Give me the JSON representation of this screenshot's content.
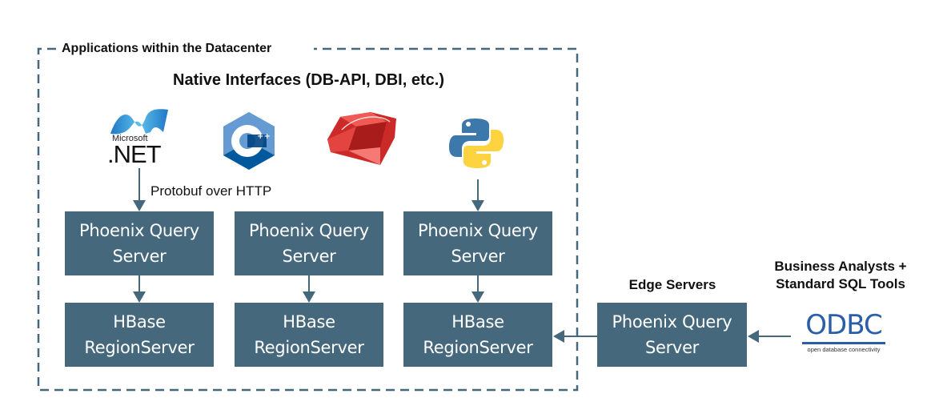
{
  "container": {
    "title": "Applications within the Datacenter",
    "subtitle": "Native Interfaces (DB-API, DBI, etc.)"
  },
  "logos": [
    {
      "name": "dotnet",
      "text_top": "Microsoft",
      "text_main": ".NET"
    },
    {
      "name": "cpp",
      "text": "C++"
    },
    {
      "name": "ruby"
    },
    {
      "name": "python"
    }
  ],
  "connector_label": "Protobuf over HTTP",
  "query_servers": [
    {
      "label": "Phoenix Query\nServer"
    },
    {
      "label": "Phoenix Query\nServer"
    },
    {
      "label": "Phoenix Query\nServer"
    }
  ],
  "region_servers": [
    {
      "label": "HBase\nRegionServer"
    },
    {
      "label": "HBase\nRegionServer"
    },
    {
      "label": "HBase\nRegionServer"
    }
  ],
  "edge": {
    "heading": "Edge Servers",
    "server_label": "Phoenix Query\nServer"
  },
  "analysts": {
    "heading": "Business Analysts +\nStandard SQL Tools",
    "odbc_logo": "ODBC",
    "odbc_tagline": "open database connectivity"
  },
  "colors": {
    "box": "#46687c",
    "arrow": "#46687c",
    "border": "#46687c",
    "odbc": "#2a5ea8"
  }
}
